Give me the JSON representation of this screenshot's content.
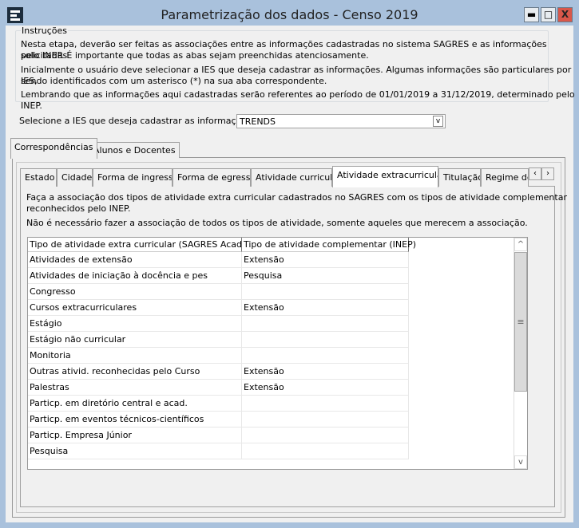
{
  "window": {
    "title": "Parametrização dos dados - Censo 2019",
    "minimize": "▬",
    "maximize": "□",
    "close": "X",
    "close_color": "#d9574a"
  },
  "instructions": {
    "legend": "Instruções",
    "lines": [
      "Nesta etapa, deverão ser feitas as associações entre as informações cadastradas no sistema SAGRES e as informações solicitadas",
      "pelo INEP. É importante que todas as abas sejam preenchidas atenciosamente.",
      "Inicialmente o usuário deve selecionar a IES que deseja cadastrar as informações. Algumas informações são particulares por IES,",
      "sendo identificados com um asterisco (*) na sua aba correspondente.",
      "Lembrando que as informações aqui cadastradas serão referentes ao período de 01/01/2019 a 31/12/2019, determinado pelo INEP."
    ]
  },
  "ies": {
    "label": "Selecione a IES que deseja cadastrar as informações:",
    "value": "TRENDS"
  },
  "outer_tabs": [
    {
      "label": "Correspondências",
      "active": true
    },
    {
      "label": "Alunos e Docentes"
    }
  ],
  "inner_tabs": [
    {
      "label": "Estado"
    },
    {
      "label": "Cidade"
    },
    {
      "label": "Forma de ingresso"
    },
    {
      "label": "Forma de egresso"
    },
    {
      "label": "Atividade curricular"
    },
    {
      "label": "Atividade extracurricular",
      "active": true
    },
    {
      "label": "Titulação"
    },
    {
      "label": "Regime de"
    }
  ],
  "tab_scroll": {
    "left": "‹",
    "right": "›"
  },
  "panel": {
    "lines": [
      "Faça a associação dos tipos de atividade extra curricular cadastrados no SAGRES com os tipos de atividade complementar",
      "reconhecidos pelo INEP.",
      "Não é necessário fazer a associação de todos os tipos de atividade, somente aqueles que merecem a associação."
    ]
  },
  "grid": {
    "columns": [
      "Tipo de atividade extra curricular (SAGRES Acadêmico)",
      "Tipo de atividade complementar (INEP)"
    ],
    "rows": [
      [
        "Atividades de extensão",
        "Extensão"
      ],
      [
        "Atividades de iniciação à docência e pes",
        "Pesquisa"
      ],
      [
        "Congresso",
        ""
      ],
      [
        "Cursos extracurriculares",
        "Extensão"
      ],
      [
        "Estágio",
        ""
      ],
      [
        "Estágio não curricular",
        ""
      ],
      [
        "Monitoria",
        ""
      ],
      [
        "Outras ativid. reconhecidas pelo Curso",
        "Extensão"
      ],
      [
        "Palestras",
        "Extensão"
      ],
      [
        "Particp. em diretório central e acad.",
        ""
      ],
      [
        "Particp. em eventos técnicos-científicos",
        ""
      ],
      [
        "Particp. Empresa Júnior",
        ""
      ],
      [
        "Pesquisa",
        ""
      ]
    ]
  }
}
